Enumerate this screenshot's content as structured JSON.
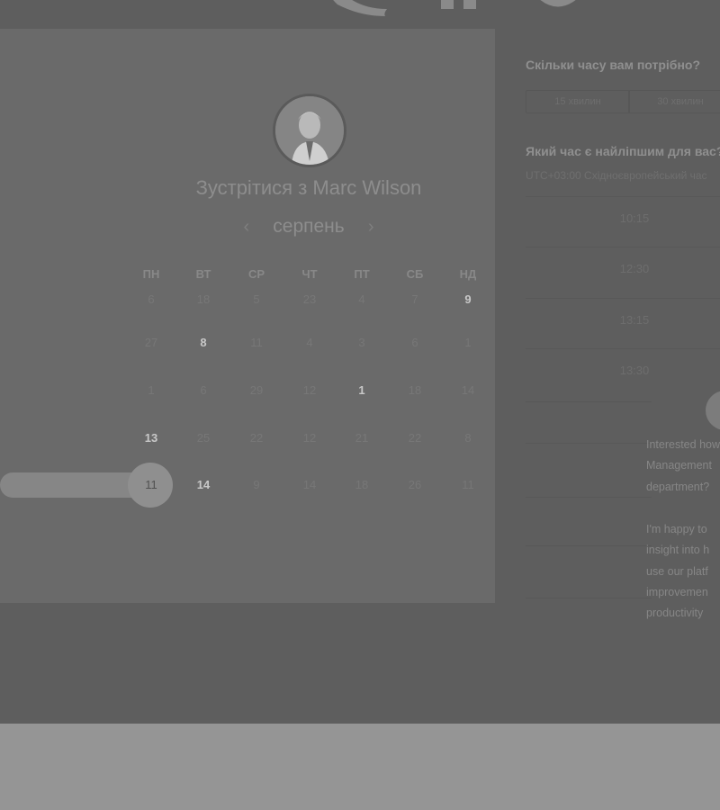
{
  "header": {
    "logo": ""
  },
  "booking": {
    "title": "Зустрітися з Marc Wilson",
    "month": "серпень",
    "prev_month": "‹",
    "next_month": "›",
    "weekdays": [
      "ПН",
      "ВТ",
      "СР",
      "ЧТ",
      "ПТ",
      "СБ",
      "НД"
    ],
    "weeks": [
      [
        "6",
        "18",
        "5",
        "23",
        "4",
        "7",
        "9"
      ],
      [
        "27",
        "8",
        "11",
        "4",
        "3",
        "6",
        "1"
      ],
      [
        "1",
        "6",
        "29",
        "12",
        "1",
        "18",
        "14"
      ],
      [
        "13",
        "25",
        "22",
        "12",
        "21",
        "22",
        "8"
      ],
      [
        "11",
        "14",
        "9",
        "14",
        "18",
        "26",
        "11"
      ]
    ],
    "available_days": [
      "9",
      "8",
      "1",
      "13",
      "14"
    ],
    "selected_day": "11"
  },
  "duration": {
    "question": "Скільки часу вам потрібно?",
    "options": [
      "15 хвилин",
      "30 хвилин"
    ]
  },
  "time": {
    "question": "Який час є найліпшим для вас?",
    "timezone": "UTC+03:00 Східноєвропейський час",
    "slots": [
      "10:15",
      "12:30",
      "13:15",
      "13:30"
    ]
  },
  "chat": {
    "message1": [
      "Interested how",
      "Management",
      "department?"
    ],
    "message2": [
      "I'm happy to",
      "insight into h",
      "use our platf",
      "improvemen",
      "productivity"
    ]
  },
  "colors": {
    "overlay": "#5e5e5e",
    "footer": "#959595"
  }
}
